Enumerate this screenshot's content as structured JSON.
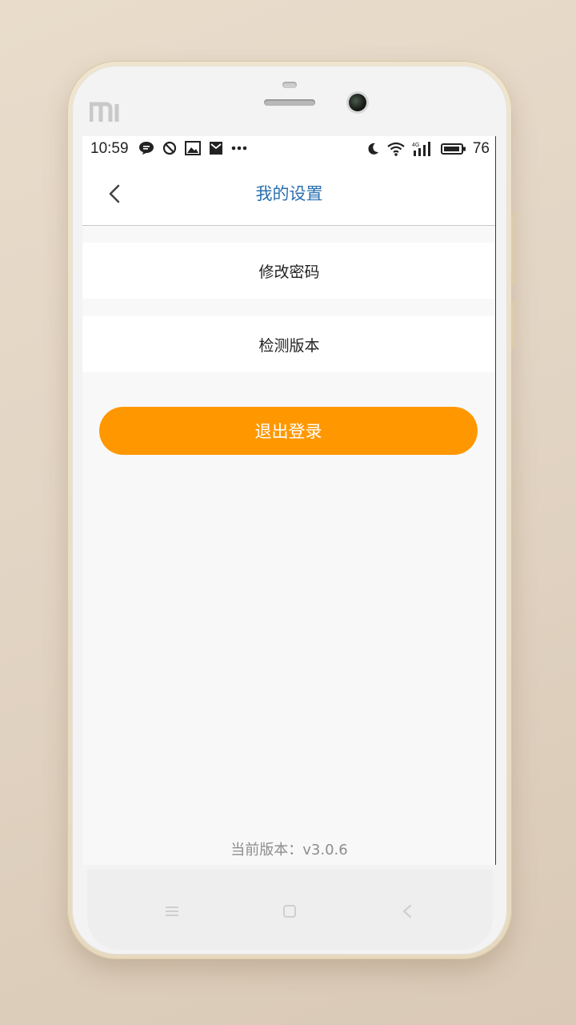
{
  "status_bar": {
    "time": "10:59",
    "battery": "76",
    "network_type": "4G",
    "left_icons": [
      "chat-bubble-icon",
      "block-icon",
      "image-icon",
      "mail-icon",
      "more-dots-icon"
    ],
    "right_icons": [
      "moon-icon",
      "wifi-icon",
      "signal-icon",
      "battery-icon"
    ]
  },
  "header": {
    "title": "我的设置",
    "back_icon": "chevron-left-icon"
  },
  "menu": {
    "items": [
      {
        "label": "修改密码"
      },
      {
        "label": "检测版本"
      }
    ]
  },
  "logout": {
    "label": "退出登录"
  },
  "footer": {
    "version_text": "当前版本：v3.0.6"
  },
  "nav": {
    "icons": [
      "menu-icon",
      "home-icon",
      "back-icon"
    ]
  },
  "colors": {
    "accent": "#ff9800",
    "title": "#2a6fb0",
    "background": "#f8f8f8",
    "muted_text": "#8d8d8d"
  }
}
